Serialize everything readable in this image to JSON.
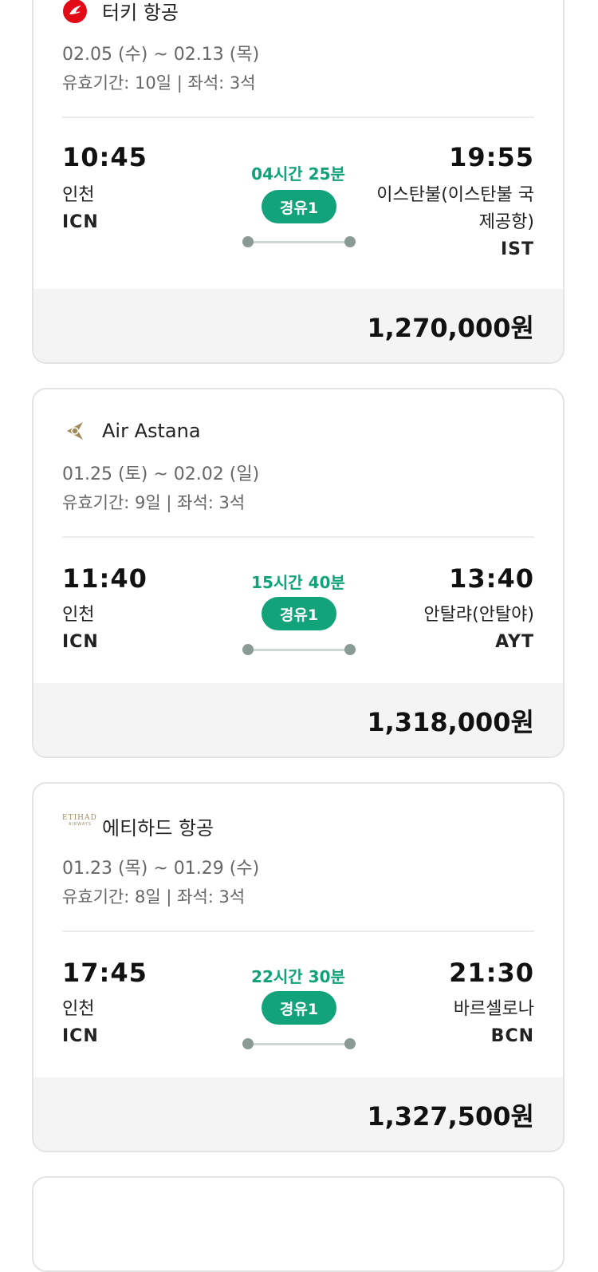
{
  "flights": [
    {
      "airline": "터키 항공",
      "logo": "turkish-airlines-logo",
      "dates": "02.05 (수) ~ 02.13 (목)",
      "validity": "유효기간: 10일 | 좌석: 3석",
      "dep_time": "10:45",
      "dep_city": "인천",
      "dep_code": "ICN",
      "duration": "04시간 25분",
      "stops": "경유1",
      "arr_time": "19:55",
      "arr_city_line1": "이스탄불(이스탄불 국",
      "arr_city_line2": "제공항)",
      "arr_code": "IST",
      "price": "1,270,000원"
    },
    {
      "airline": "Air Astana",
      "logo": "air-astana-logo",
      "dates": "01.25 (토) ~ 02.02 (일)",
      "validity": "유효기간: 9일 | 좌석: 3석",
      "dep_time": "11:40",
      "dep_city": "인천",
      "dep_code": "ICN",
      "duration": "15시간 40분",
      "stops": "경유1",
      "arr_time": "13:40",
      "arr_city_line1": "안탈랴(안탈야)",
      "arr_code": "AYT",
      "price": "1,318,000원"
    },
    {
      "airline": "에티하드 항공",
      "logo": "etihad-logo",
      "logo_text": "ETIHAD",
      "logo_sub": "AIRWAYS",
      "dates": "01.23 (목) ~ 01.29 (수)",
      "validity": "유효기간: 8일 | 좌석: 3석",
      "dep_time": "17:45",
      "dep_city": "인천",
      "dep_code": "ICN",
      "duration": "22시간 30분",
      "stops": "경유1",
      "arr_time": "21:30",
      "arr_city_line1": "바르셀로나",
      "arr_code": "BCN",
      "price": "1,327,500원"
    }
  ],
  "colors": {
    "accent": "#12a37b",
    "duration": "#10a37a",
    "price_bg": "#f4f4f4",
    "turkish_red": "#e30a17",
    "astana_gold": "#a08c5b"
  }
}
